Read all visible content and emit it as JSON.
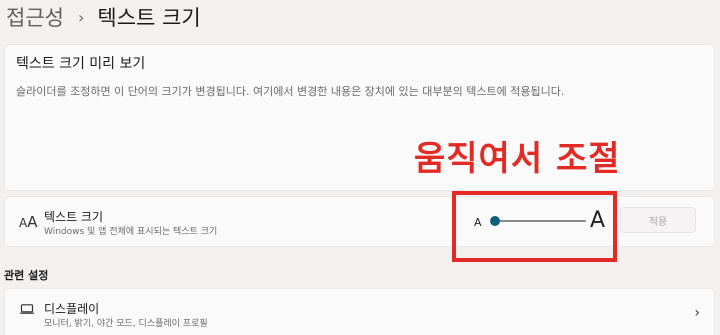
{
  "breadcrumb": {
    "parent": "접근성",
    "separator": "›",
    "current": "텍스트 크기"
  },
  "preview": {
    "title": "텍스트 크기 미리 보기",
    "description": "슬라이더를 조정하면 이 단어의 크기가 변경됩니다. 여기에서 변경한 내용은 장치에 있는 대부분의 텍스트에 적용됩니다."
  },
  "annotation": {
    "text": "움직여서 조절",
    "color": "#e42a24"
  },
  "text_size_row": {
    "icon": "text-size-icon",
    "icon_small_glyph": "A",
    "icon_large_glyph": "A",
    "title": "텍스트 크기",
    "subtitle": "Windows 및 앱 전체에 표시되는 텍스트 크기",
    "slider": {
      "min_label": "A",
      "max_label": "A",
      "value_percent": 0,
      "accent_color": "#0e6078"
    },
    "apply_label": "적용"
  },
  "related_settings": {
    "header": "관련 설정",
    "items": [
      {
        "icon": "monitor-icon",
        "title": "디스플레이",
        "subtitle": "모니터, 밝기, 야간 모드, 디스플레이 프로필",
        "chevron": "›"
      }
    ]
  }
}
